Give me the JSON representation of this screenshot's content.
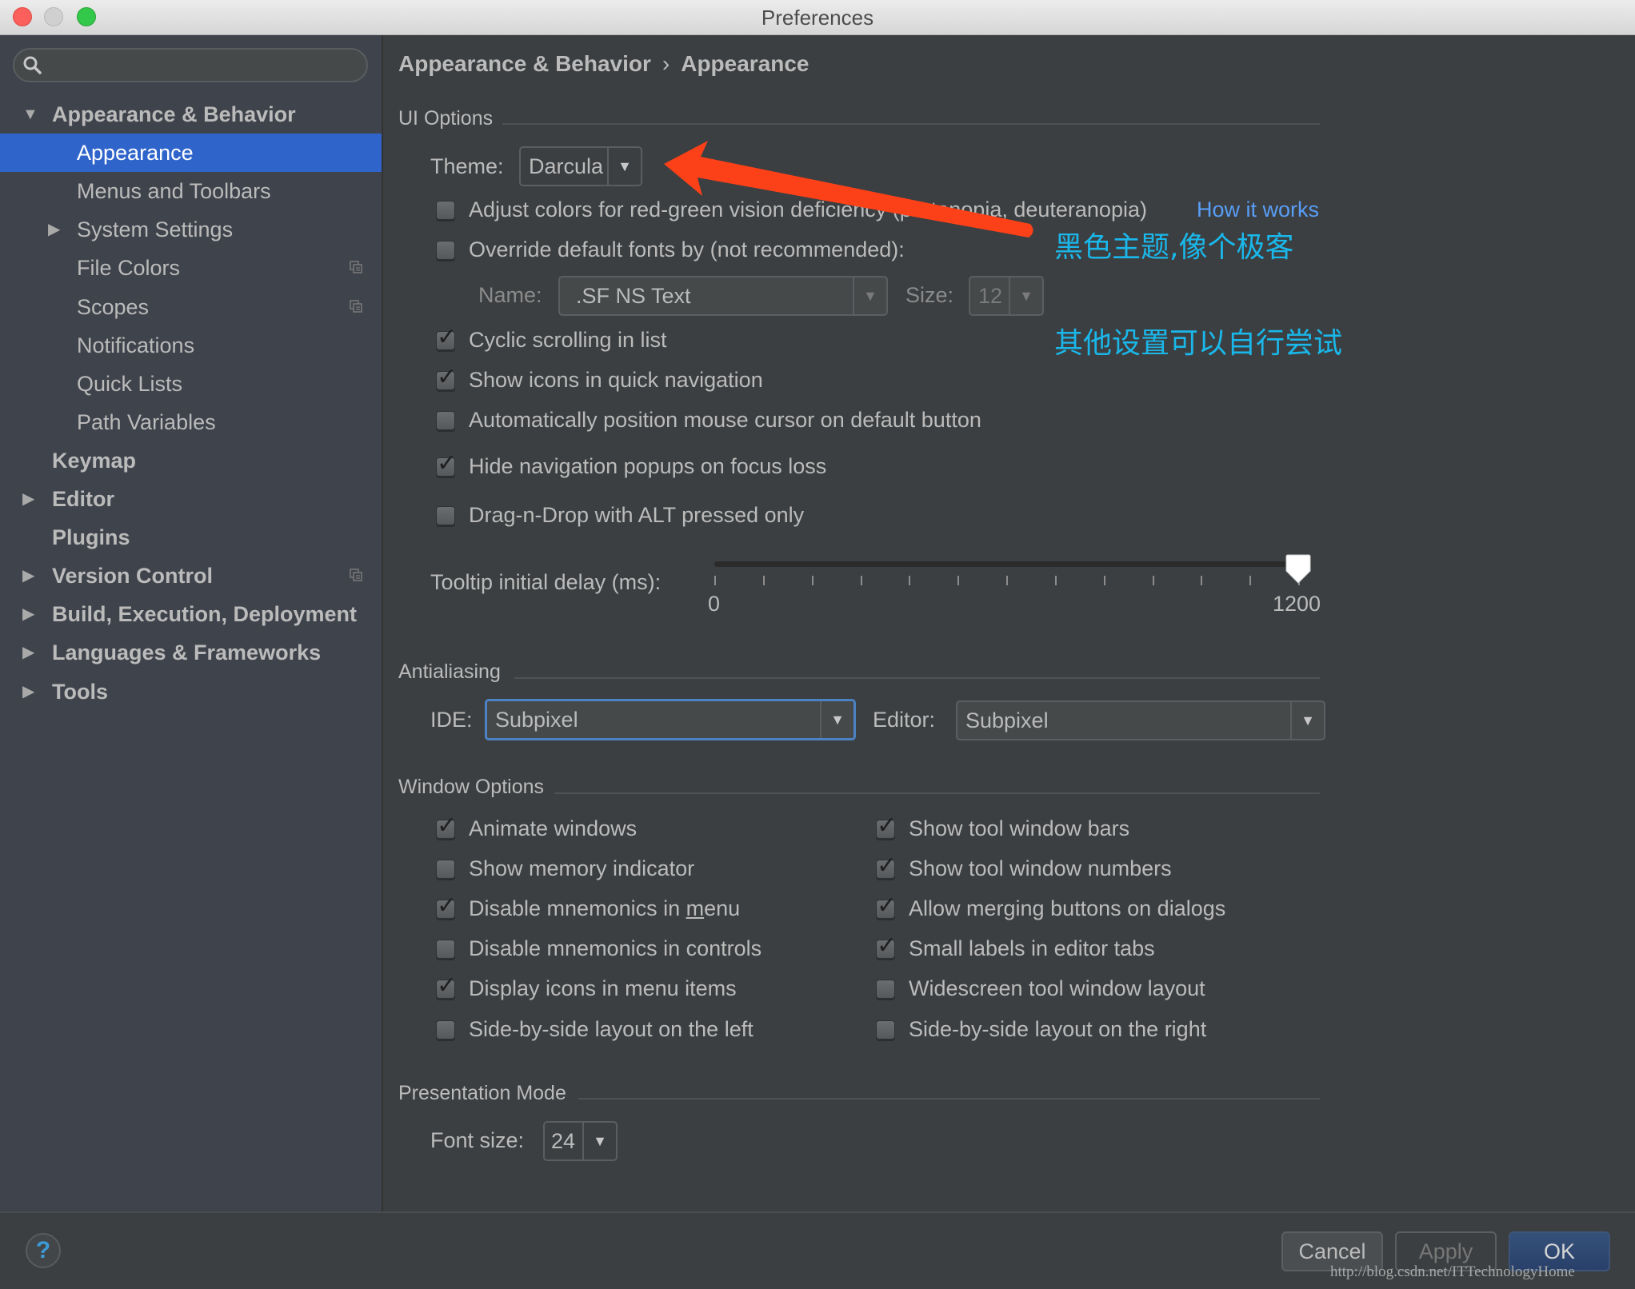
{
  "window": {
    "title": "Preferences"
  },
  "search": {
    "placeholder": "",
    "value": ""
  },
  "sidebar": {
    "items": [
      {
        "label": "Appearance & Behavior",
        "level": 0,
        "expandable": true,
        "expanded": true,
        "bold": true
      },
      {
        "label": "Appearance",
        "level": 1,
        "selected": true
      },
      {
        "label": "Menus and Toolbars",
        "level": 1
      },
      {
        "label": "System Settings",
        "level": 1,
        "expandable": true,
        "expanded": false
      },
      {
        "label": "File Colors",
        "level": 1,
        "project_icon": true
      },
      {
        "label": "Scopes",
        "level": 1,
        "project_icon": true
      },
      {
        "label": "Notifications",
        "level": 1
      },
      {
        "label": "Quick Lists",
        "level": 1
      },
      {
        "label": "Path Variables",
        "level": 1
      },
      {
        "label": "Keymap",
        "level": 0,
        "bold": true
      },
      {
        "label": "Editor",
        "level": 0,
        "expandable": true,
        "expanded": false,
        "bold": true
      },
      {
        "label": "Plugins",
        "level": 0,
        "bold": true
      },
      {
        "label": "Version Control",
        "level": 0,
        "expandable": true,
        "expanded": false,
        "bold": true,
        "project_icon": true
      },
      {
        "label": "Build, Execution, Deployment",
        "level": 0,
        "expandable": true,
        "expanded": false,
        "bold": true
      },
      {
        "label": "Languages & Frameworks",
        "level": 0,
        "expandable": true,
        "expanded": false,
        "bold": true
      },
      {
        "label": "Tools",
        "level": 0,
        "expandable": true,
        "expanded": false,
        "bold": true
      }
    ]
  },
  "breadcrumb": {
    "parent": "Appearance & Behavior",
    "separator": "›",
    "current": "Appearance"
  },
  "ui_options": {
    "section_title": "UI Options",
    "theme_label": "Theme:",
    "theme_value": "Darcula",
    "adjust_colors": {
      "label": "Adjust colors for red-green vision deficiency (protanopia, deuteranopia)",
      "checked": false
    },
    "how_it_works_link": "How it works",
    "override_fonts": {
      "label": "Override default fonts by (not recommended):",
      "checked": false
    },
    "font_name_label": "Name:",
    "font_name_value": ".SF NS Text",
    "font_size_label": "Size:",
    "font_size_value": "12",
    "checkboxes": [
      {
        "label": "Cyclic scrolling in list",
        "checked": true
      },
      {
        "label": "Show icons in quick navigation",
        "checked": true
      },
      {
        "label": "Automatically position mouse cursor on default button",
        "checked": false
      },
      {
        "label": "Hide navigation popups on focus loss",
        "checked": true
      },
      {
        "label": "Drag-n-Drop with ALT pressed only",
        "checked": false
      }
    ],
    "tooltip_delay": {
      "label": "Tooltip initial delay (ms):",
      "min": 0,
      "max": 1200,
      "value": 1200,
      "tick_step": 100,
      "min_label": "0",
      "max_label": "1200"
    }
  },
  "antialiasing": {
    "section_title": "Antialiasing",
    "ide_label": "IDE:",
    "ide_value": "Subpixel",
    "editor_label": "Editor:",
    "editor_value": "Subpixel"
  },
  "window_options": {
    "section_title": "Window Options",
    "left": [
      {
        "label": "Animate windows",
        "checked": true
      },
      {
        "label": "Show memory indicator",
        "checked": false
      },
      {
        "label": "Disable mnemonics in menu",
        "checked": true
      },
      {
        "label": "Disable mnemonics in controls",
        "checked": false
      },
      {
        "label": "Display icons in menu items",
        "checked": true
      },
      {
        "label": "Side-by-side layout on the left",
        "checked": false
      }
    ],
    "right": [
      {
        "label": "Show tool window bars",
        "checked": true
      },
      {
        "label": "Show tool window numbers",
        "checked": true
      },
      {
        "label": "Allow merging buttons on dialogs",
        "checked": true
      },
      {
        "label": "Small labels in editor tabs",
        "checked": true
      },
      {
        "label": "Widescreen tool window layout",
        "checked": false
      },
      {
        "label": "Side-by-side layout on the right",
        "checked": false
      }
    ]
  },
  "presentation_mode": {
    "section_title": "Presentation Mode",
    "font_size_label": "Font size:",
    "font_size_value": "24"
  },
  "annotations": {
    "note1": "黑色主题,像个极客",
    "note2": "其他设置可以自行尝试",
    "arrow_color": "#fc4119",
    "text_color": "#1ab7ea"
  },
  "footer": {
    "help": "?",
    "cancel": "Cancel",
    "apply": "Apply",
    "ok": "OK",
    "watermark": "http://blog.csdn.net/ITTechnologyHome"
  },
  "colors": {
    "selection": "#2f65ca",
    "link": "#589df6",
    "panel_bg": "#3c3f41",
    "sidebar_bg": "#3f434b"
  }
}
